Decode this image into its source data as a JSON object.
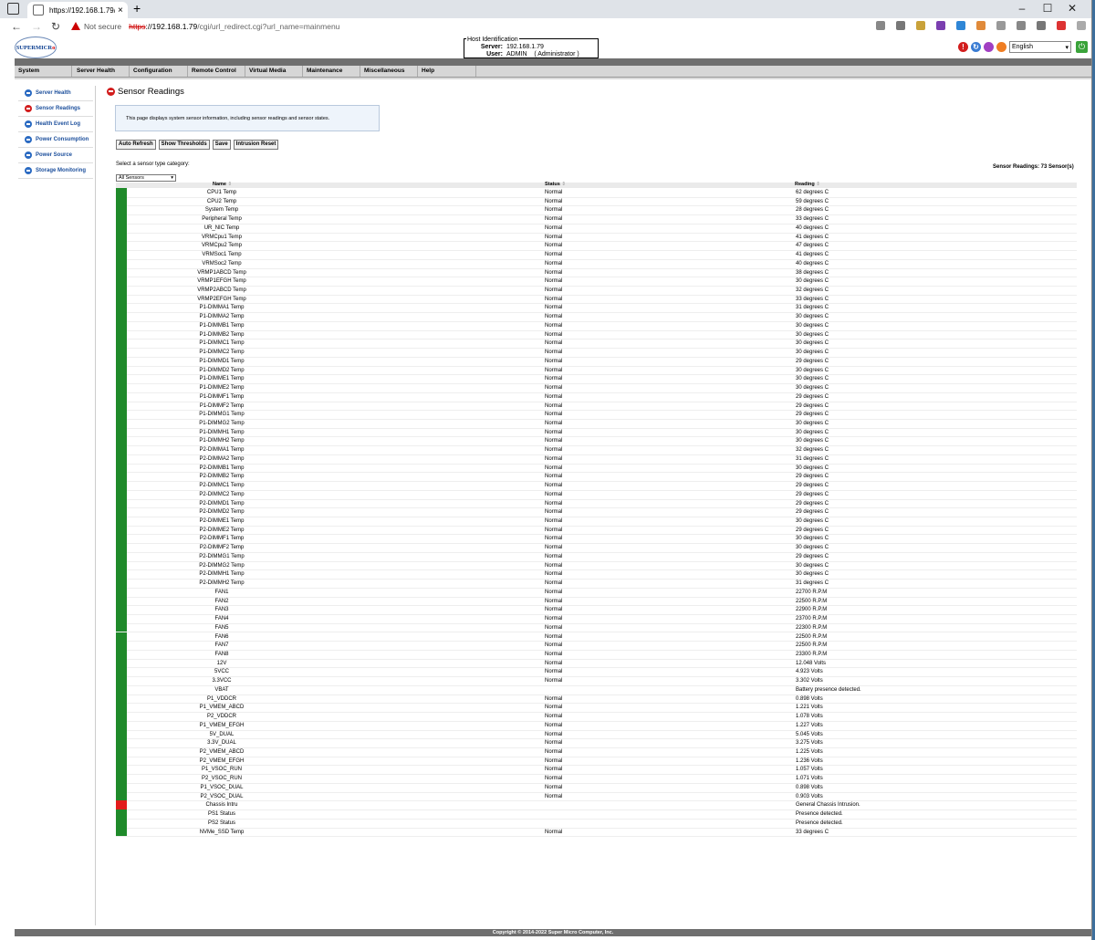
{
  "browser": {
    "tab_title": "https://192.168.1.79/cgi/url_redi",
    "close_glyph": "×",
    "new_tab_glyph": "+",
    "minimize_glyph": "–",
    "maximize_glyph": "☐",
    "window_close_glyph": "✕",
    "back_glyph": "←",
    "forward_glyph": "→",
    "reload_glyph": "↻",
    "not_secure": "Not secure",
    "url_proto": "https",
    "url_host": "://192.168.1.79",
    "url_path": "/cgi/url_redirect.cgi?url_name=mainmenu"
  },
  "header": {
    "logo_text": "SUPERMICR",
    "logo_dot": "o",
    "hostid_legend": "Host Identification",
    "server_label": "Server:",
    "server_value": "192.168.1.79",
    "user_label": "User:",
    "user_value": "ADMIN",
    "user_role": "( Administrator )",
    "language": "English",
    "alert_glyph": "!",
    "refresh_glyph": "↻",
    "power_glyph": "⏻"
  },
  "menu": {
    "items": [
      "System",
      "Server Health",
      "Configuration",
      "Remote Control",
      "Virtual Media",
      "Maintenance",
      "Miscellaneous",
      "Help"
    ]
  },
  "sidebar": {
    "items": [
      {
        "label": "Server Health"
      },
      {
        "label": "Sensor Readings"
      },
      {
        "label": "Health Event Log"
      },
      {
        "label": "Power Consumption"
      },
      {
        "label": "Power Source"
      },
      {
        "label": "Storage Monitoring"
      }
    ]
  },
  "main": {
    "title": "Sensor Readings",
    "info": "This page displays system sensor information, including sensor readings and sensor states.",
    "buttons": [
      "Auto Refresh",
      "Show Thresholds",
      "Save",
      "Intrusion Reset"
    ],
    "category_prompt": "Select a sensor type category:",
    "category_selected": "All Sensors",
    "sensor_count": "Sensor Readings: 73 Sensor(s)",
    "columns": {
      "name": "Name",
      "status": "Status",
      "reading": "Reading",
      "sort_glyph": "⇕"
    }
  },
  "colors": {
    "normal": "#1f8a2a",
    "alert": "#e21b1b"
  },
  "sensors": [
    {
      "name": "CPU1 Temp",
      "status": "Normal",
      "reading": "62 degrees C",
      "state": "ok"
    },
    {
      "name": "CPU2 Temp",
      "status": "Normal",
      "reading": "59 degrees C",
      "state": "ok"
    },
    {
      "name": "System Temp",
      "status": "Normal",
      "reading": "28 degrees C",
      "state": "ok"
    },
    {
      "name": "Peripheral Temp",
      "status": "Normal",
      "reading": "33 degrees C",
      "state": "ok"
    },
    {
      "name": "UR_NIC Temp",
      "status": "Normal",
      "reading": "40 degrees C",
      "state": "ok"
    },
    {
      "name": "VRMCpu1 Temp",
      "status": "Normal",
      "reading": "41 degrees C",
      "state": "ok"
    },
    {
      "name": "VRMCpu2 Temp",
      "status": "Normal",
      "reading": "47 degrees C",
      "state": "ok"
    },
    {
      "name": "VRMSoc1 Temp",
      "status": "Normal",
      "reading": "41 degrees C",
      "state": "ok"
    },
    {
      "name": "VRMSoc2 Temp",
      "status": "Normal",
      "reading": "40 degrees C",
      "state": "ok"
    },
    {
      "name": "VRMP1ABCD Temp",
      "status": "Normal",
      "reading": "38 degrees C",
      "state": "ok"
    },
    {
      "name": "VRMP1EFGH Temp",
      "status": "Normal",
      "reading": "30 degrees C",
      "state": "ok"
    },
    {
      "name": "VRMP2ABCD Temp",
      "status": "Normal",
      "reading": "32 degrees C",
      "state": "ok"
    },
    {
      "name": "VRMP2EFGH Temp",
      "status": "Normal",
      "reading": "33 degrees C",
      "state": "ok"
    },
    {
      "name": "P1-DIMMA1 Temp",
      "status": "Normal",
      "reading": "31 degrees C",
      "state": "ok"
    },
    {
      "name": "P1-DIMMA2 Temp",
      "status": "Normal",
      "reading": "30 degrees C",
      "state": "ok"
    },
    {
      "name": "P1-DIMMB1 Temp",
      "status": "Normal",
      "reading": "30 degrees C",
      "state": "ok"
    },
    {
      "name": "P1-DIMMB2 Temp",
      "status": "Normal",
      "reading": "30 degrees C",
      "state": "ok"
    },
    {
      "name": "P1-DIMMC1 Temp",
      "status": "Normal",
      "reading": "30 degrees C",
      "state": "ok"
    },
    {
      "name": "P1-DIMMC2 Temp",
      "status": "Normal",
      "reading": "30 degrees C",
      "state": "ok"
    },
    {
      "name": "P1-DIMMD1 Temp",
      "status": "Normal",
      "reading": "29 degrees C",
      "state": "ok"
    },
    {
      "name": "P1-DIMMD2 Temp",
      "status": "Normal",
      "reading": "30 degrees C",
      "state": "ok"
    },
    {
      "name": "P1-DIMME1 Temp",
      "status": "Normal",
      "reading": "30 degrees C",
      "state": "ok"
    },
    {
      "name": "P1-DIMME2 Temp",
      "status": "Normal",
      "reading": "30 degrees C",
      "state": "ok"
    },
    {
      "name": "P1-DIMMF1 Temp",
      "status": "Normal",
      "reading": "29 degrees C",
      "state": "ok"
    },
    {
      "name": "P1-DIMMF2 Temp",
      "status": "Normal",
      "reading": "29 degrees C",
      "state": "ok"
    },
    {
      "name": "P1-DIMMG1 Temp",
      "status": "Normal",
      "reading": "29 degrees C",
      "state": "ok"
    },
    {
      "name": "P1-DIMMG2 Temp",
      "status": "Normal",
      "reading": "30 degrees C",
      "state": "ok"
    },
    {
      "name": "P1-DIMMH1 Temp",
      "status": "Normal",
      "reading": "30 degrees C",
      "state": "ok"
    },
    {
      "name": "P1-DIMMH2 Temp",
      "status": "Normal",
      "reading": "30 degrees C",
      "state": "ok"
    },
    {
      "name": "P2-DIMMA1 Temp",
      "status": "Normal",
      "reading": "32 degrees C",
      "state": "ok"
    },
    {
      "name": "P2-DIMMA2 Temp",
      "status": "Normal",
      "reading": "31 degrees C",
      "state": "ok"
    },
    {
      "name": "P2-DIMMB1 Temp",
      "status": "Normal",
      "reading": "30 degrees C",
      "state": "ok"
    },
    {
      "name": "P2-DIMMB2 Temp",
      "status": "Normal",
      "reading": "29 degrees C",
      "state": "ok"
    },
    {
      "name": "P2-DIMMC1 Temp",
      "status": "Normal",
      "reading": "29 degrees C",
      "state": "ok"
    },
    {
      "name": "P2-DIMMC2 Temp",
      "status": "Normal",
      "reading": "29 degrees C",
      "state": "ok"
    },
    {
      "name": "P2-DIMMD1 Temp",
      "status": "Normal",
      "reading": "29 degrees C",
      "state": "ok"
    },
    {
      "name": "P2-DIMMD2 Temp",
      "status": "Normal",
      "reading": "29 degrees C",
      "state": "ok"
    },
    {
      "name": "P2-DIMME1 Temp",
      "status": "Normal",
      "reading": "30 degrees C",
      "state": "ok"
    },
    {
      "name": "P2-DIMME2 Temp",
      "status": "Normal",
      "reading": "29 degrees C",
      "state": "ok"
    },
    {
      "name": "P2-DIMMF1 Temp",
      "status": "Normal",
      "reading": "30 degrees C",
      "state": "ok"
    },
    {
      "name": "P2-DIMMF2 Temp",
      "status": "Normal",
      "reading": "30 degrees C",
      "state": "ok"
    },
    {
      "name": "P2-DIMMG1 Temp",
      "status": "Normal",
      "reading": "29 degrees C",
      "state": "ok"
    },
    {
      "name": "P2-DIMMG2 Temp",
      "status": "Normal",
      "reading": "30 degrees C",
      "state": "ok"
    },
    {
      "name": "P2-DIMMH1 Temp",
      "status": "Normal",
      "reading": "30 degrees C",
      "state": "ok"
    },
    {
      "name": "P2-DIMMH2 Temp",
      "status": "Normal",
      "reading": "31 degrees C",
      "state": "ok"
    },
    {
      "name": "FAN1",
      "status": "Normal",
      "reading": "22700 R.P.M",
      "state": "ok"
    },
    {
      "name": "FAN2",
      "status": "Normal",
      "reading": "22500 R.P.M",
      "state": "ok"
    },
    {
      "name": "FAN3",
      "status": "Normal",
      "reading": "22900 R.P.M",
      "state": "ok"
    },
    {
      "name": "FAN4",
      "status": "Normal",
      "reading": "23700 R.P.M",
      "state": "ok"
    },
    {
      "name": "FAN5",
      "status": "Normal",
      "reading": "22300 R.P.M",
      "state": "ok"
    },
    {
      "name": "FAN6",
      "status": "Normal",
      "reading": "22500 R.P.M",
      "state": "ok"
    },
    {
      "name": "FAN7",
      "status": "Normal",
      "reading": "22500 R.P.M",
      "state": "ok"
    },
    {
      "name": "FAN8",
      "status": "Normal",
      "reading": "23300 R.P.M",
      "state": "ok"
    },
    {
      "name": "12V",
      "status": "Normal",
      "reading": "12.048 Volts",
      "state": "ok"
    },
    {
      "name": "5VCC",
      "status": "Normal",
      "reading": "4.923 Volts",
      "state": "ok"
    },
    {
      "name": "3.3VCC",
      "status": "Normal",
      "reading": "3.302 Volts",
      "state": "ok"
    },
    {
      "name": "VBAT",
      "status": "",
      "reading": "Battery presence detected.",
      "state": "ok"
    },
    {
      "name": "P1_VDDCR",
      "status": "Normal",
      "reading": "0.898 Volts",
      "state": "ok"
    },
    {
      "name": "P1_VMEM_ABCD",
      "status": "Normal",
      "reading": "1.221 Volts",
      "state": "ok"
    },
    {
      "name": "P2_VDDCR",
      "status": "Normal",
      "reading": "1.078 Volts",
      "state": "ok"
    },
    {
      "name": "P1_VMEM_EFGH",
      "status": "Normal",
      "reading": "1.227 Volts",
      "state": "ok"
    },
    {
      "name": "5V_DUAL",
      "status": "Normal",
      "reading": "5.045 Volts",
      "state": "ok"
    },
    {
      "name": "3.3V_DUAL",
      "status": "Normal",
      "reading": "3.275 Volts",
      "state": "ok"
    },
    {
      "name": "P2_VMEM_ABCD",
      "status": "Normal",
      "reading": "1.225 Volts",
      "state": "ok"
    },
    {
      "name": "P2_VMEM_EFGH",
      "status": "Normal",
      "reading": "1.236 Volts",
      "state": "ok"
    },
    {
      "name": "P1_VSOC_RUN",
      "status": "Normal",
      "reading": "1.057 Volts",
      "state": "ok"
    },
    {
      "name": "P2_VSOC_RUN",
      "status": "Normal",
      "reading": "1.071 Volts",
      "state": "ok"
    },
    {
      "name": "P1_VSOC_DUAL",
      "status": "Normal",
      "reading": "0.898 Volts",
      "state": "ok"
    },
    {
      "name": "P2_VSOC_DUAL",
      "status": "Normal",
      "reading": "0.903 Volts",
      "state": "ok"
    },
    {
      "name": "Chassis Intru",
      "status": "",
      "reading": "General Chassis Intrusion.",
      "state": "alert"
    },
    {
      "name": "PS1 Status",
      "status": "",
      "reading": "Presence detected.",
      "state": "ok"
    },
    {
      "name": "PS2 Status",
      "status": "",
      "reading": "Presence detected.",
      "state": "ok"
    },
    {
      "name": "NVMe_SSD Temp",
      "status": "Normal",
      "reading": "33 degrees C",
      "state": "ok"
    }
  ],
  "footer": {
    "copyright": "Copyright © 2014-2022 Super Micro Computer, Inc."
  }
}
